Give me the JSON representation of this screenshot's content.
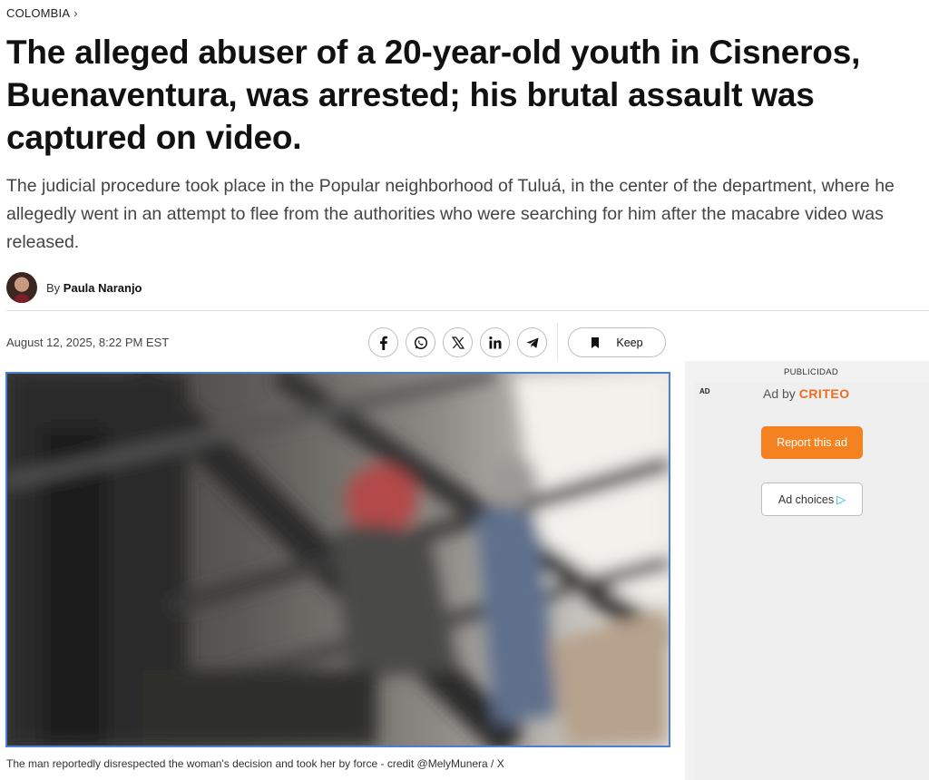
{
  "breadcrumb": {
    "section": "COLOMBIA",
    "chevron": "›"
  },
  "article": {
    "headline": "The alleged abuser of a 20-year-old youth in Cisneros, Buenaventura, was arrested; his brutal assault was captured on video.",
    "subtitle": "The judicial procedure took place in the Popular neighborhood of Tuluá, in the center of the department, where he allegedly went in an attempt to flee from the authorities who were searching for him after the macabre video was released.",
    "author_prefix": "By",
    "author_name": "Paula Naranjo",
    "date": "August 12, 2025, 8:22 PM EST",
    "caption": "The man reportedly disrespected the woman's decision and took her by force - credit @MelyMunera / X"
  },
  "share": {
    "icons": [
      "facebook-icon",
      "whatsapp-icon",
      "x-icon",
      "linkedin-icon",
      "telegram-icon"
    ]
  },
  "keep": {
    "label": "Keep",
    "icon": "bookmark-icon"
  },
  "ad": {
    "label": "PUBLICIDAD",
    "tag": "AD",
    "by_prefix": "Ad by",
    "brand": "CRITEO",
    "report_label": "Report this ad",
    "choices_label": "Ad choices",
    "choices_icon": "▷"
  },
  "colors": {
    "brand_orange": "#f58220",
    "photo_border": "#4a7fd1",
    "adchoices_blue": "#19b6d8"
  }
}
